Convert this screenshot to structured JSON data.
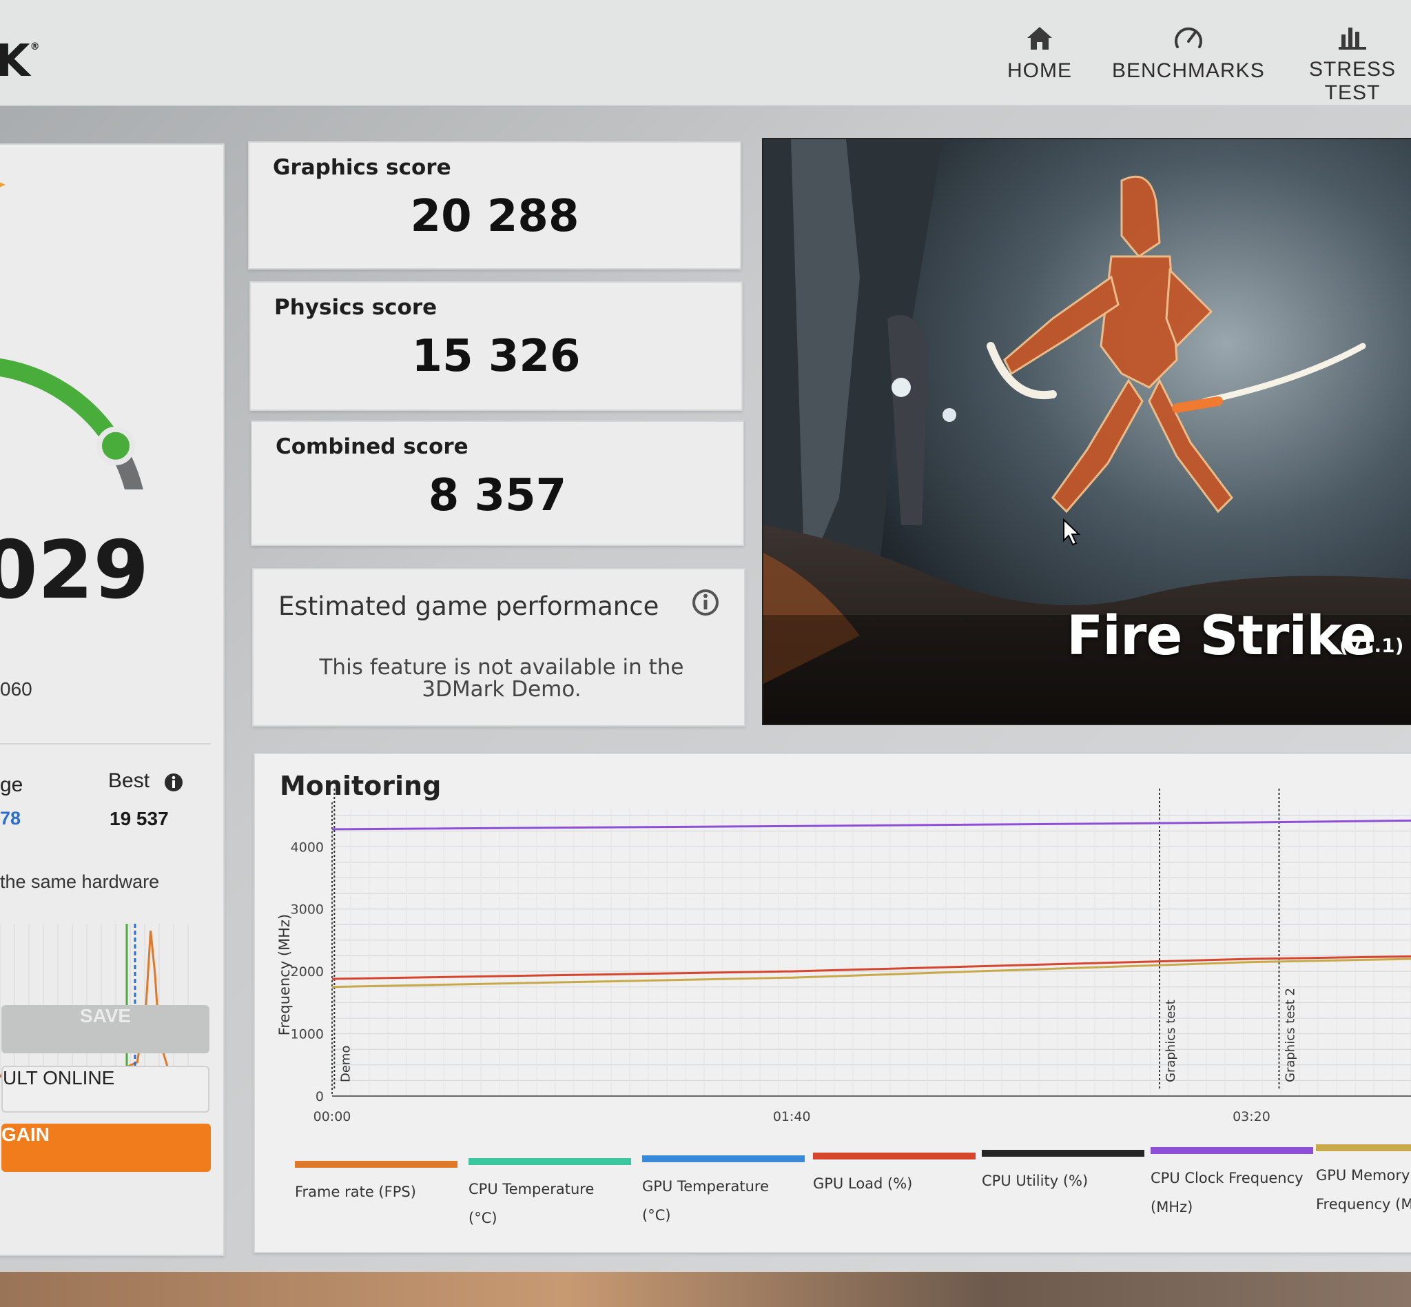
{
  "app": {
    "logo": "K",
    "logo_mark": "®"
  },
  "nav": [
    {
      "label": "HOME",
      "icon": "home-icon"
    },
    {
      "label": "BENCHMARKS",
      "icon": "gauge-icon"
    },
    {
      "label": "STRESS TEST",
      "icon": "bar-chart-icon"
    }
  ],
  "summary": {
    "total_score": "029",
    "gpu_name": "060",
    "average_label": "ge",
    "average_value": "78",
    "best_label": "Best",
    "best_value": "19 537",
    "same_hardware_text": "the same hardware",
    "hist_tick_left": "0",
    "hist_tick_right": "15000",
    "gauge_level": 0.78,
    "colors": {
      "gauge": "#49ad3c",
      "gauge_track": "#6e7072",
      "accent": "#f07c1c",
      "average": "#2a6fd0"
    }
  },
  "buttons": {
    "save": "SAVE",
    "online": "ULT ONLINE",
    "again": "GAIN"
  },
  "scores": {
    "graphics_label": "Graphics score",
    "graphics_value": "20 288",
    "physics_label": "Physics score",
    "physics_value": "15 326",
    "combined_label": "Combined score",
    "combined_value": "8 357"
  },
  "egp": {
    "title": "Estimated game performance",
    "text": "This feature is not available in the 3DMark Demo."
  },
  "benchmark": {
    "title": "Fire Strike",
    "version": "(v1.1)"
  },
  "monitoring": {
    "title": "Monitoring",
    "legend": [
      {
        "label": "Frame rate (FPS)",
        "color": "#e0782a"
      },
      {
        "label": "CPU Temperature (°C)",
        "color": "#3cc7a0"
      },
      {
        "label": "GPU Temperature (°C)",
        "color": "#3a88d8"
      },
      {
        "label": "GPU Load (%)",
        "color": "#d6452e"
      },
      {
        "label": "CPU Utility (%)",
        "color": "#262626"
      },
      {
        "label": "CPU Clock Frequency (MHz)",
        "color": "#8d4fd6"
      },
      {
        "label": "GPU Memory Frequency (MHz)",
        "color": "#c8a94a"
      }
    ]
  },
  "chart_data": [
    {
      "type": "line",
      "title": "Monitoring",
      "ylabel": "Frequency (MHz)",
      "xlabel": "",
      "ylim": [
        0,
        4600
      ],
      "y_ticks": [
        "0",
        "1000",
        "2000",
        "3000",
        "4000"
      ],
      "x_ticks": [
        "00:00",
        "01:40",
        "03:20"
      ],
      "grid": true,
      "markers": [
        "Demo",
        "Graphics test",
        "Graphics test 2"
      ],
      "series": [
        {
          "name": "CPU Clock Frequency (MHz)",
          "x": [
            0,
            100,
            200,
            235
          ],
          "y": [
            4280,
            4330,
            4390,
            4420
          ]
        },
        {
          "name": "GPU Load (%)",
          "x": [
            0,
            100,
            200,
            235
          ],
          "y": [
            1880,
            2000,
            2200,
            2240
          ]
        },
        {
          "name": "GPU Memory Frequency (MHz)",
          "x": [
            0,
            100,
            200,
            235
          ],
          "y": [
            1750,
            1900,
            2150,
            2200
          ]
        }
      ]
    },
    {
      "type": "line",
      "title": "",
      "x_ticks": [
        "0",
        "15000"
      ],
      "series": [
        {
          "name": "",
          "x": [
            0,
            6000,
            13000,
            15500,
            16500,
            17000,
            17500,
            18000,
            19000,
            21000
          ],
          "y": [
            0.01,
            0.01,
            0.03,
            0.1,
            0.5,
            1.0,
            0.7,
            0.25,
            0.05,
            0.01
          ]
        }
      ]
    }
  ]
}
